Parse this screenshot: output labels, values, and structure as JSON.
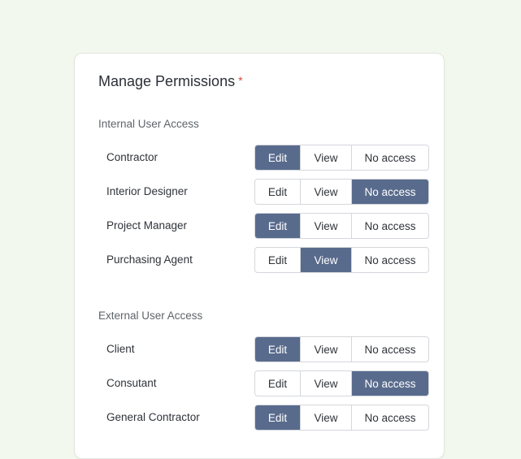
{
  "title": "Manage Permissions",
  "required_marker": "*",
  "colors": {
    "active_segment": "#596b8d",
    "required": "#d9463c",
    "page_background": "#f3f8ee"
  },
  "options": {
    "edit": "Edit",
    "view": "View",
    "none": "No access"
  },
  "sections": [
    {
      "label": "Internal User Access",
      "rows": [
        {
          "role": "Contractor",
          "selected": "edit"
        },
        {
          "role": "Interior Designer",
          "selected": "none"
        },
        {
          "role": "Project Manager",
          "selected": "edit"
        },
        {
          "role": "Purchasing Agent",
          "selected": "view"
        }
      ]
    },
    {
      "label": "External User Access",
      "rows": [
        {
          "role": "Client",
          "selected": "edit"
        },
        {
          "role": "Consutant",
          "selected": "none"
        },
        {
          "role": "General Contractor",
          "selected": "edit"
        }
      ]
    }
  ]
}
